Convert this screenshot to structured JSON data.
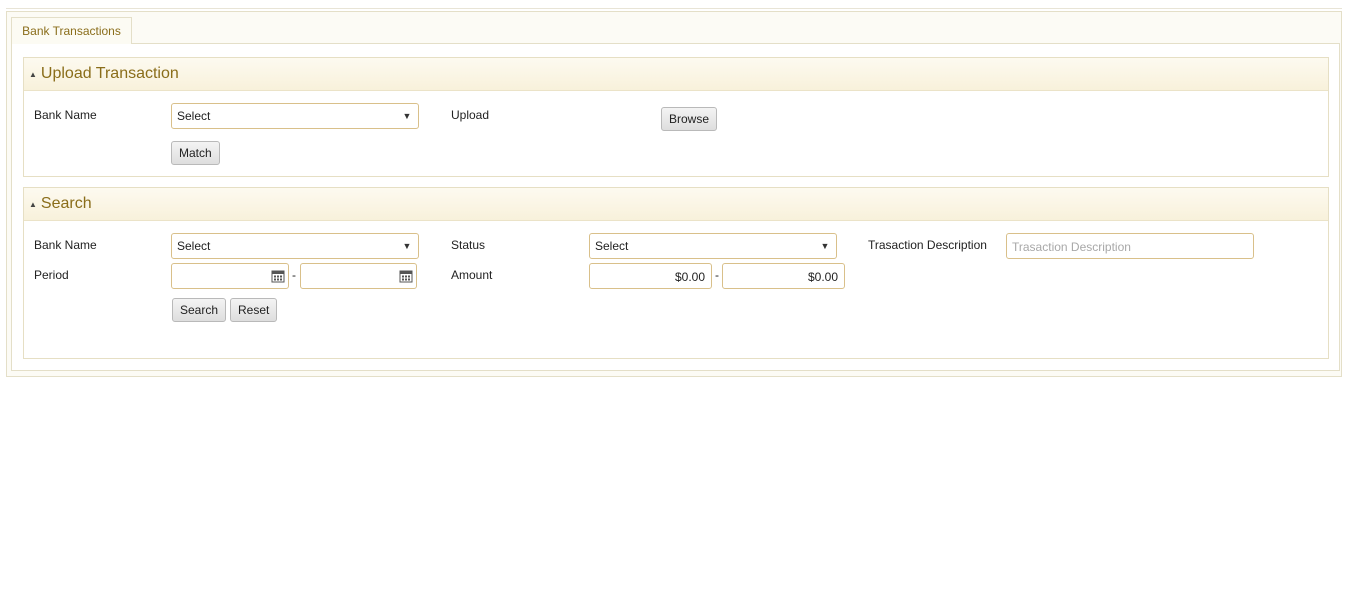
{
  "tabs": [
    {
      "label": "Bank Transactions"
    }
  ],
  "upload_panel": {
    "title": "Upload Transaction",
    "bank_name_label": "Bank Name",
    "bank_select_value": "Select",
    "upload_label": "Upload",
    "browse_label": "Browse",
    "match_label": "Match"
  },
  "search_panel": {
    "title": "Search",
    "bank_name_label": "Bank Name",
    "bank_select_value": "Select",
    "status_label": "Status",
    "status_select_value": "Select",
    "description_label": "Trasaction Description",
    "description_placeholder": "Trasaction Description",
    "period_label": "Period",
    "period_from": "",
    "period_to": "",
    "dash": "-",
    "amount_label": "Amount",
    "amount_from": "$0.00",
    "amount_to": "$0.00",
    "search_label": "Search",
    "reset_label": "Reset"
  },
  "icons": {
    "collapse": "triangle-up",
    "dropdown": "chevron-down",
    "calendar": "calendar"
  }
}
